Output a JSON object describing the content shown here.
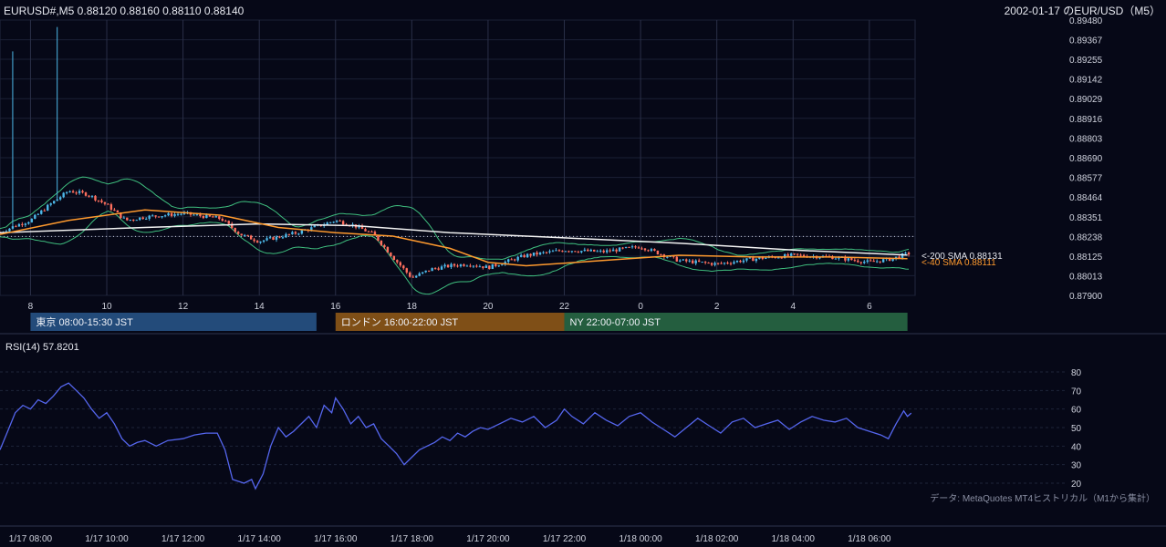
{
  "header": {
    "symbol_ohlc": "EURUSD#,M5 0.88120 0.88160 0.88110 0.88140",
    "date_title": "2002-01-17 のEUR/USD（M5）"
  },
  "sessions": [
    {
      "label": "東京 08:00-15:30 JST",
      "start_hour": 8.0,
      "end_hour": 15.5,
      "color": "#234b7a"
    },
    {
      "label": "ロンドン 16:00-22:00 JST",
      "start_hour": 16.0,
      "end_hour": 22.0,
      "color": "#7f4f17"
    },
    {
      "label": "NY 22:00-07:00 JST",
      "start_hour": 22.0,
      "end_hour": 31.0,
      "color": "#245e3f"
    }
  ],
  "ma_labels": {
    "sma200": "<-200 SMA 0.88131",
    "sma40": "<-40 SMA 0.88111"
  },
  "rsi": {
    "title": "RSI(14) 57.8201",
    "yticks": [
      80,
      70,
      60,
      50,
      40,
      30,
      20
    ],
    "ylim": [
      15,
      85
    ]
  },
  "bottom_axis_labels": [
    "1/17 08:00",
    "1/17 10:00",
    "1/17 12:00",
    "1/17 14:00",
    "1/17 16:00",
    "1/17 18:00",
    "1/17 20:00",
    "1/17 22:00",
    "1/18 00:00",
    "1/18 02:00",
    "1/18 04:00",
    "1/18 06:00"
  ],
  "source_note": "データ: MetaQuotes MT4ヒストリカル（M1から集計）",
  "colors": {
    "background": "#060817",
    "grid": "#1b2036",
    "bull": "#4db8e8",
    "bear": "#ff6f5e",
    "bollinger": "#3fbf7f",
    "sma40": "#ff9a2e",
    "sma200": "#f2f2f2",
    "rsi_line": "#5566ee"
  },
  "chart_data": [
    {
      "type": "candlestick",
      "title": "EURUSD#,M5",
      "x_tick_labels": [
        "8",
        "10",
        "12",
        "14",
        "16",
        "18",
        "20",
        "22",
        "0",
        "2",
        "4",
        "6"
      ],
      "y_ticks": [
        0.8948,
        0.89367,
        0.89255,
        0.89142,
        0.89029,
        0.88916,
        0.88803,
        0.8869,
        0.88577,
        0.88464,
        0.88351,
        0.88238,
        0.88125,
        0.88013,
        0.879
      ],
      "ylim": [
        0.879,
        0.8948
      ],
      "x_range_hours": [
        7.2,
        31.2
      ],
      "dotted_reference_level": 0.88238,
      "price_path": [
        {
          "hour": 7.2,
          "price": 0.8826
        },
        {
          "hour": 7.6,
          "price": 0.883
        },
        {
          "hour": 8.0,
          "price": 0.8833
        },
        {
          "hour": 8.5,
          "price": 0.8842
        },
        {
          "hour": 9.0,
          "price": 0.885
        },
        {
          "hour": 9.5,
          "price": 0.8848
        },
        {
          "hour": 10.0,
          "price": 0.8842
        },
        {
          "hour": 10.5,
          "price": 0.8833
        },
        {
          "hour": 11.0,
          "price": 0.8835
        },
        {
          "hour": 12.0,
          "price": 0.8837
        },
        {
          "hour": 13.0,
          "price": 0.8834
        },
        {
          "hour": 13.5,
          "price": 0.8825
        },
        {
          "hour": 14.0,
          "price": 0.8821
        },
        {
          "hour": 15.0,
          "price": 0.8826
        },
        {
          "hour": 16.0,
          "price": 0.8833
        },
        {
          "hour": 16.5,
          "price": 0.883
        },
        {
          "hour": 17.0,
          "price": 0.8825
        },
        {
          "hour": 17.5,
          "price": 0.8812
        },
        {
          "hour": 18.0,
          "price": 0.88
        },
        {
          "hour": 18.5,
          "price": 0.8805
        },
        {
          "hour": 19.0,
          "price": 0.8807
        },
        {
          "hour": 19.5,
          "price": 0.8808
        },
        {
          "hour": 20.0,
          "price": 0.8806
        },
        {
          "hour": 21.0,
          "price": 0.8813
        },
        {
          "hour": 22.0,
          "price": 0.8816
        },
        {
          "hour": 23.0,
          "price": 0.8815
        },
        {
          "hour": 24.0,
          "price": 0.8818
        },
        {
          "hour": 25.0,
          "price": 0.881
        },
        {
          "hour": 26.0,
          "price": 0.8808
        },
        {
          "hour": 27.0,
          "price": 0.8811
        },
        {
          "hour": 28.0,
          "price": 0.8813
        },
        {
          "hour": 29.0,
          "price": 0.8812
        },
        {
          "hour": 30.0,
          "price": 0.8809
        },
        {
          "hour": 30.6,
          "price": 0.8811
        },
        {
          "hour": 31.0,
          "price": 0.8814
        }
      ],
      "spikes": [
        {
          "hour": 7.55,
          "high": 0.893
        },
        {
          "hour": 8.7,
          "high": 0.8944
        }
      ],
      "sma40": [
        {
          "hour": 7.2,
          "price": 0.8825
        },
        {
          "hour": 9.0,
          "price": 0.8833
        },
        {
          "hour": 11.0,
          "price": 0.8839
        },
        {
          "hour": 13.0,
          "price": 0.8836
        },
        {
          "hour": 14.5,
          "price": 0.8829
        },
        {
          "hour": 16.0,
          "price": 0.8826
        },
        {
          "hour": 17.5,
          "price": 0.8824
        },
        {
          "hour": 19.0,
          "price": 0.8817
        },
        {
          "hour": 20.0,
          "price": 0.8809
        },
        {
          "hour": 21.0,
          "price": 0.8807
        },
        {
          "hour": 23.0,
          "price": 0.881
        },
        {
          "hour": 25.0,
          "price": 0.8813
        },
        {
          "hour": 27.0,
          "price": 0.8812
        },
        {
          "hour": 29.0,
          "price": 0.8812
        },
        {
          "hour": 31.0,
          "price": 0.88111
        }
      ],
      "sma200": [
        {
          "hour": 7.2,
          "price": 0.8826
        },
        {
          "hour": 11.0,
          "price": 0.8829
        },
        {
          "hour": 14.0,
          "price": 0.8831
        },
        {
          "hour": 16.5,
          "price": 0.883
        },
        {
          "hour": 19.0,
          "price": 0.8826
        },
        {
          "hour": 22.0,
          "price": 0.8823
        },
        {
          "hour": 25.0,
          "price": 0.882
        },
        {
          "hour": 28.0,
          "price": 0.8816
        },
        {
          "hour": 31.0,
          "price": 0.88131
        }
      ],
      "series_labels": [
        "200 SMA 0.88131",
        "40 SMA 0.88111"
      ]
    },
    {
      "type": "line",
      "title": "RSI(14) 57.8201",
      "ylim": [
        15,
        85
      ],
      "y_ticks": [
        80,
        70,
        60,
        50,
        40,
        30,
        20
      ],
      "x_range_hours": [
        7.2,
        31.2
      ],
      "points": [
        {
          "hour": 7.2,
          "value": 38
        },
        {
          "hour": 7.4,
          "value": 48
        },
        {
          "hour": 7.6,
          "value": 58
        },
        {
          "hour": 7.8,
          "value": 62
        },
        {
          "hour": 8.0,
          "value": 60
        },
        {
          "hour": 8.2,
          "value": 65
        },
        {
          "hour": 8.4,
          "value": 63
        },
        {
          "hour": 8.6,
          "value": 67
        },
        {
          "hour": 8.8,
          "value": 72
        },
        {
          "hour": 9.0,
          "value": 74
        },
        {
          "hour": 9.2,
          "value": 70
        },
        {
          "hour": 9.4,
          "value": 66
        },
        {
          "hour": 9.6,
          "value": 60
        },
        {
          "hour": 9.8,
          "value": 55
        },
        {
          "hour": 10.0,
          "value": 58
        },
        {
          "hour": 10.2,
          "value": 52
        },
        {
          "hour": 10.4,
          "value": 44
        },
        {
          "hour": 10.6,
          "value": 40
        },
        {
          "hour": 10.8,
          "value": 42
        },
        {
          "hour": 11.0,
          "value": 43
        },
        {
          "hour": 11.3,
          "value": 40
        },
        {
          "hour": 11.6,
          "value": 43
        },
        {
          "hour": 12.0,
          "value": 44
        },
        {
          "hour": 12.3,
          "value": 46
        },
        {
          "hour": 12.6,
          "value": 47
        },
        {
          "hour": 12.9,
          "value": 47
        },
        {
          "hour": 13.1,
          "value": 38
        },
        {
          "hour": 13.3,
          "value": 22
        },
        {
          "hour": 13.6,
          "value": 20
        },
        {
          "hour": 13.8,
          "value": 22
        },
        {
          "hour": 13.9,
          "value": 17
        },
        {
          "hour": 14.1,
          "value": 25
        },
        {
          "hour": 14.3,
          "value": 40
        },
        {
          "hour": 14.5,
          "value": 50
        },
        {
          "hour": 14.7,
          "value": 45
        },
        {
          "hour": 14.9,
          "value": 48
        },
        {
          "hour": 15.1,
          "value": 52
        },
        {
          "hour": 15.3,
          "value": 56
        },
        {
          "hour": 15.5,
          "value": 50
        },
        {
          "hour": 15.7,
          "value": 62
        },
        {
          "hour": 15.9,
          "value": 58
        },
        {
          "hour": 16.0,
          "value": 66
        },
        {
          "hour": 16.2,
          "value": 60
        },
        {
          "hour": 16.4,
          "value": 52
        },
        {
          "hour": 16.6,
          "value": 56
        },
        {
          "hour": 16.8,
          "value": 50
        },
        {
          "hour": 17.0,
          "value": 52
        },
        {
          "hour": 17.2,
          "value": 44
        },
        {
          "hour": 17.4,
          "value": 40
        },
        {
          "hour": 17.6,
          "value": 36
        },
        {
          "hour": 17.8,
          "value": 30
        },
        {
          "hour": 18.0,
          "value": 34
        },
        {
          "hour": 18.2,
          "value": 38
        },
        {
          "hour": 18.4,
          "value": 40
        },
        {
          "hour": 18.6,
          "value": 42
        },
        {
          "hour": 18.8,
          "value": 45
        },
        {
          "hour": 19.0,
          "value": 43
        },
        {
          "hour": 19.2,
          "value": 47
        },
        {
          "hour": 19.4,
          "value": 45
        },
        {
          "hour": 19.6,
          "value": 48
        },
        {
          "hour": 19.8,
          "value": 50
        },
        {
          "hour": 20.0,
          "value": 49
        },
        {
          "hour": 20.3,
          "value": 52
        },
        {
          "hour": 20.6,
          "value": 55
        },
        {
          "hour": 20.9,
          "value": 53
        },
        {
          "hour": 21.2,
          "value": 56
        },
        {
          "hour": 21.5,
          "value": 50
        },
        {
          "hour": 21.8,
          "value": 54
        },
        {
          "hour": 22.0,
          "value": 60
        },
        {
          "hour": 22.2,
          "value": 56
        },
        {
          "hour": 22.5,
          "value": 52
        },
        {
          "hour": 22.8,
          "value": 58
        },
        {
          "hour": 23.1,
          "value": 54
        },
        {
          "hour": 23.4,
          "value": 51
        },
        {
          "hour": 23.7,
          "value": 56
        },
        {
          "hour": 24.0,
          "value": 58
        },
        {
          "hour": 24.3,
          "value": 53
        },
        {
          "hour": 24.6,
          "value": 49
        },
        {
          "hour": 24.9,
          "value": 45
        },
        {
          "hour": 25.2,
          "value": 50
        },
        {
          "hour": 25.5,
          "value": 55
        },
        {
          "hour": 25.8,
          "value": 51
        },
        {
          "hour": 26.1,
          "value": 47
        },
        {
          "hour": 26.4,
          "value": 53
        },
        {
          "hour": 26.7,
          "value": 55
        },
        {
          "hour": 27.0,
          "value": 50
        },
        {
          "hour": 27.3,
          "value": 52
        },
        {
          "hour": 27.6,
          "value": 54
        },
        {
          "hour": 27.9,
          "value": 49
        },
        {
          "hour": 28.2,
          "value": 53
        },
        {
          "hour": 28.5,
          "value": 56
        },
        {
          "hour": 28.8,
          "value": 54
        },
        {
          "hour": 29.1,
          "value": 53
        },
        {
          "hour": 29.4,
          "value": 55
        },
        {
          "hour": 29.7,
          "value": 50
        },
        {
          "hour": 30.0,
          "value": 48
        },
        {
          "hour": 30.3,
          "value": 46
        },
        {
          "hour": 30.5,
          "value": 44
        },
        {
          "hour": 30.7,
          "value": 52
        },
        {
          "hour": 30.9,
          "value": 59
        },
        {
          "hour": 31.0,
          "value": 56
        },
        {
          "hour": 31.1,
          "value": 57.82
        }
      ]
    }
  ]
}
